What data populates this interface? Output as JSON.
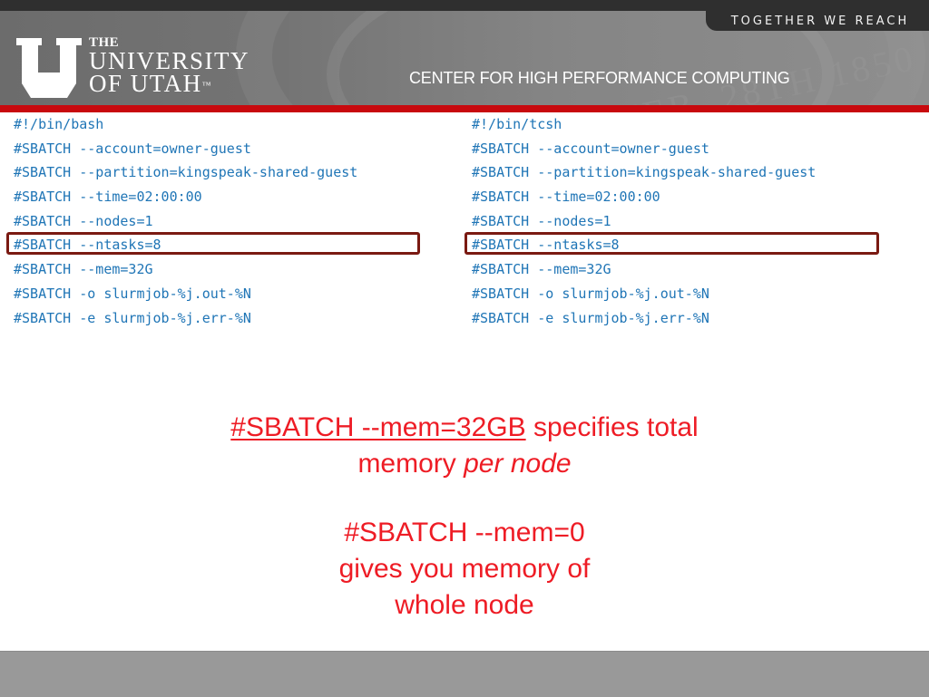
{
  "header": {
    "tagline": "TOGETHER WE REACH",
    "logo": {
      "the": "THE",
      "university": "UNIVERSITY",
      "of_utah": "OF UTAH",
      "trademark": "™"
    },
    "center_title": "CENTER FOR HIGH PERFORMANCE COMPUTING",
    "seal_text": "FEB. 28TH 1850"
  },
  "scripts": {
    "left": {
      "shell": "bash",
      "lines": [
        "#!/bin/bash",
        "#SBATCH --account=owner-guest",
        "#SBATCH --partition=kingspeak-shared-guest",
        "#SBATCH --time=02:00:00",
        "#SBATCH --nodes=1",
        "#SBATCH --ntasks=8",
        "#SBATCH --mem=32G",
        "#SBATCH -o slurmjob-%j.out-%N",
        "#SBATCH -e slurmjob-%j.err-%N"
      ],
      "highlighted_line": 5
    },
    "right": {
      "shell": "tcsh",
      "lines": [
        "#!/bin/tcsh",
        "#SBATCH --account=owner-guest",
        "#SBATCH --partition=kingspeak-shared-guest",
        "#SBATCH --time=02:00:00",
        "#SBATCH --nodes=1",
        "#SBATCH --ntasks=8",
        "#SBATCH --mem=32G",
        "#SBATCH -o slurmjob-%j.out-%N",
        "#SBATCH -e slurmjob-%j.err-%N"
      ],
      "highlighted_line": 5
    }
  },
  "notes": {
    "mem_per_node": {
      "underlined": "#SBATCH --mem=32GB",
      "rest": " specifies total",
      "line2_plain": "memory ",
      "line2_italic": "per node"
    },
    "mem_zero": {
      "line1": "#SBATCH --mem=0",
      "line2": "gives you memory of",
      "line3": "whole node"
    }
  },
  "colors": {
    "accent_red": "#c8090e",
    "note_red": "#ee1c25",
    "code_blue": "#1f75b6",
    "highlight_border": "#7a1a12"
  }
}
